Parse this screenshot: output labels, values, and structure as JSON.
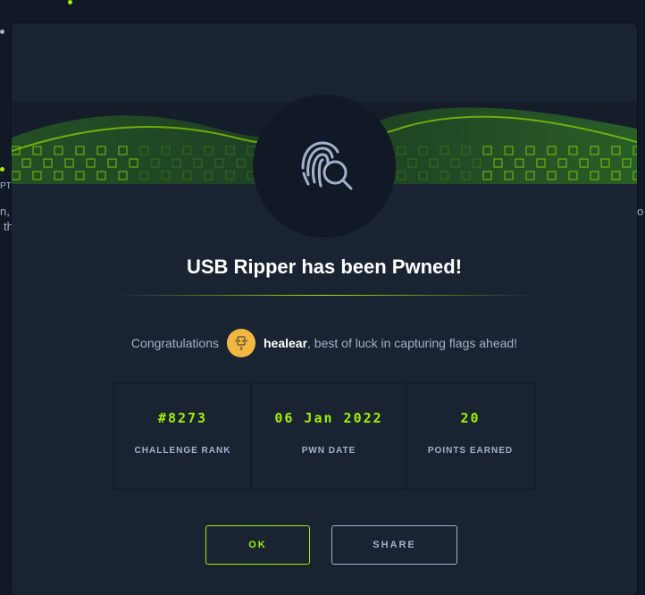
{
  "modal": {
    "title": "USB Ripper has been Pwned!",
    "congrats_prefix": "Congratulations",
    "username": "healear",
    "congrats_suffix": ", best of luck in capturing flags ahead!",
    "badge_icon": "fingerprint-search-icon",
    "avatar_icon": "user-avatar-icon"
  },
  "stats": [
    {
      "value": "#8273",
      "label": "CHALLENGE RANK"
    },
    {
      "value": "06 Jan 2022",
      "label": "PWN DATE"
    },
    {
      "value": "20",
      "label": "POINTS EARNED"
    }
  ],
  "buttons": {
    "ok": "OK",
    "share": "SHARE"
  },
  "background": {
    "left_frag_1": "PT",
    "left_frag_2": "n, ’",
    "left_frag_3": "th",
    "right_frag_1": "o"
  },
  "colors": {
    "accent": "#9fef00",
    "panel": "#1a2332",
    "page": "#111927",
    "muted": "#a4b1cd",
    "avatar": "#f2b742"
  }
}
